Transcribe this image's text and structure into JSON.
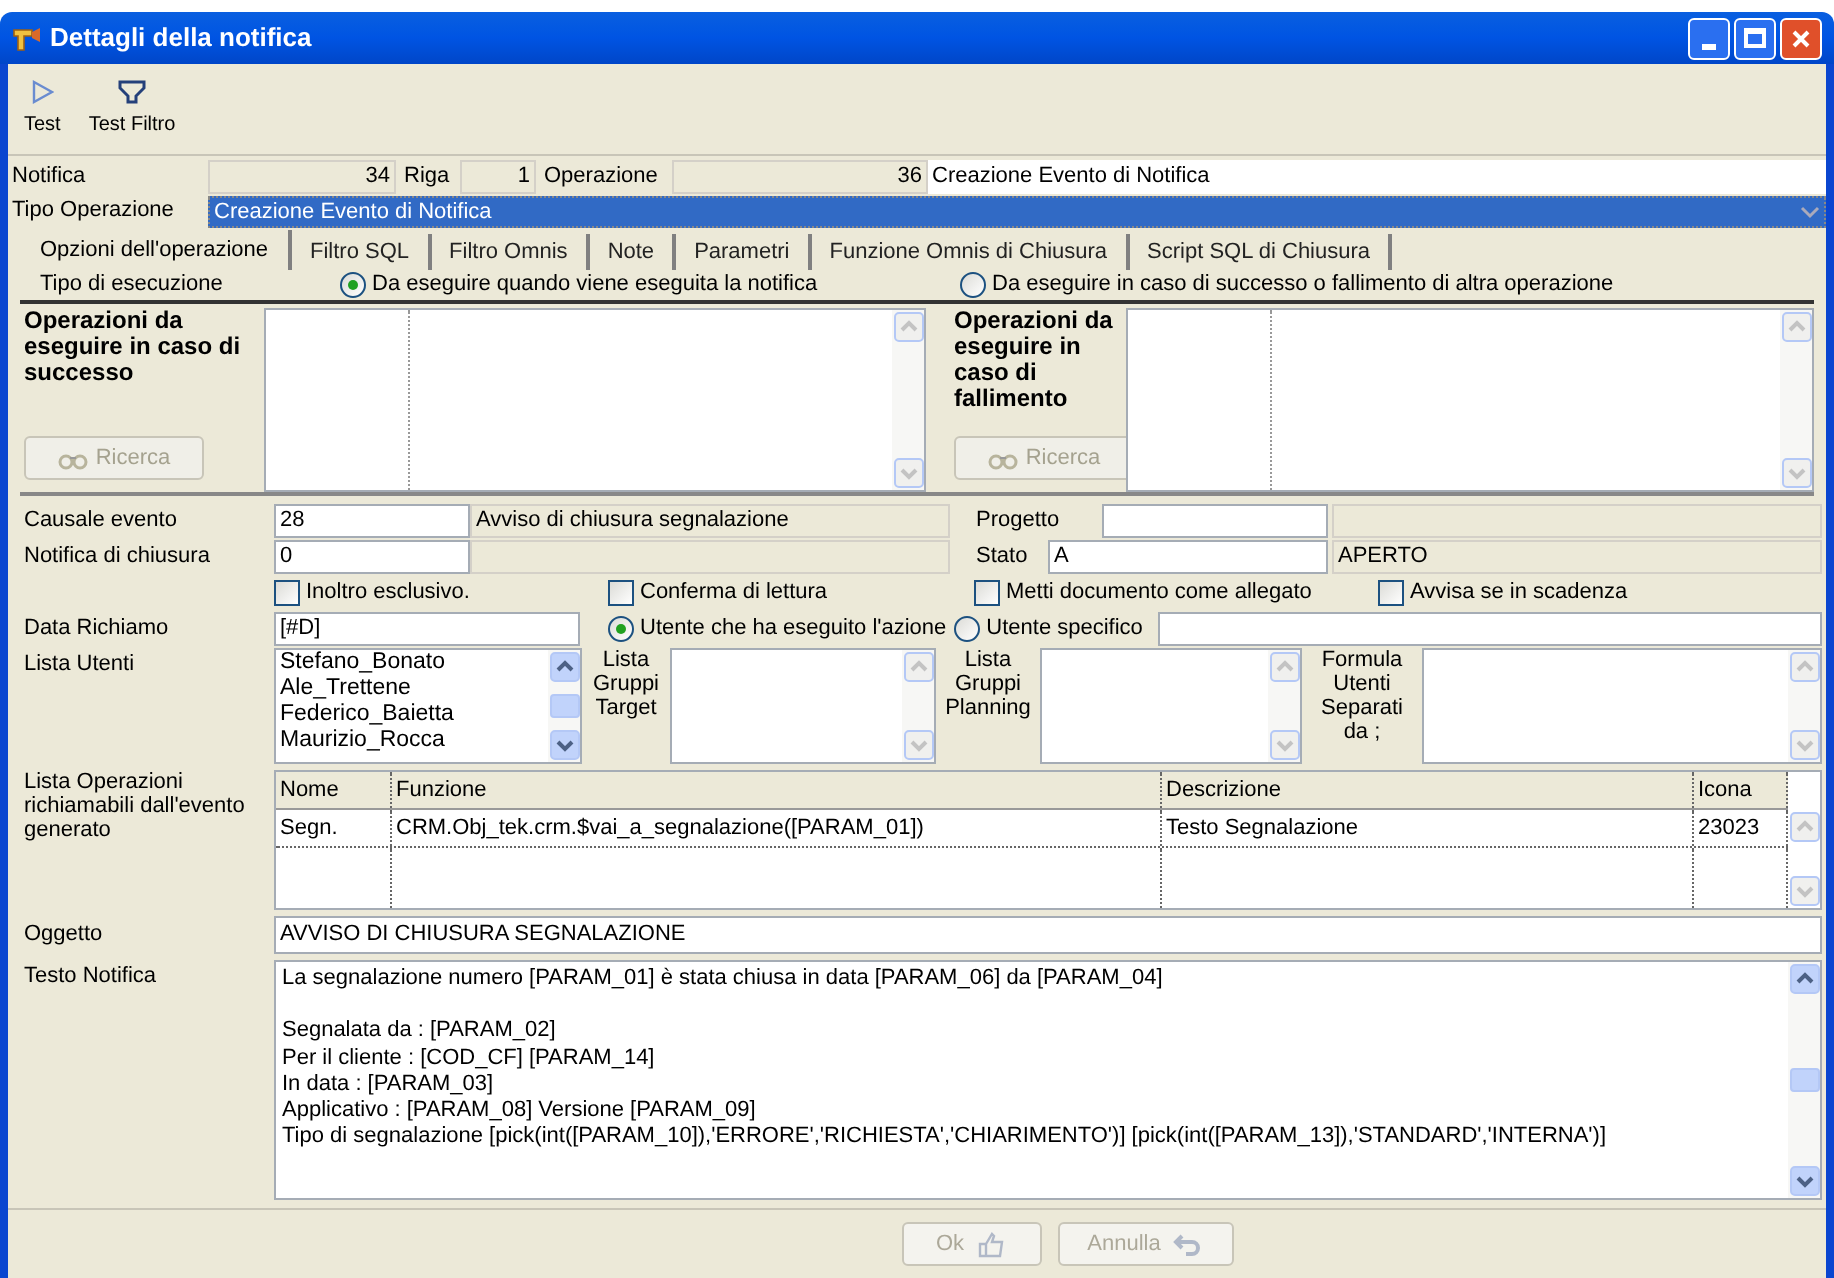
{
  "window": {
    "title": "Dettagli della notifica"
  },
  "toolbar": [
    {
      "label": "Test",
      "kind": "play"
    },
    {
      "label": "Test Filtro",
      "kind": "filter"
    }
  ],
  "header": {
    "notifica_label": "Notifica",
    "notifica": "34",
    "riga_label": "Riga",
    "riga": "1",
    "operazione_label": "Operazione",
    "operazione": "36",
    "operazione_name": "Creazione Evento di Notifica",
    "tipo_label": "Tipo Operazione",
    "tipo": "Creazione Evento di Notifica"
  },
  "tabs": [
    {
      "label": "Opzioni dell'operazione",
      "selected": true
    },
    {
      "label": "Filtro SQL",
      "selected": false
    },
    {
      "label": "Filtro Omnis",
      "selected": false
    },
    {
      "label": "Note",
      "selected": false
    },
    {
      "label": "Parametri",
      "selected": false
    },
    {
      "label": "Funzione Omnis di Chiusura",
      "selected": false
    },
    {
      "label": "Script SQL di Chiusura",
      "selected": false
    }
  ],
  "execution": {
    "label": "Tipo di esecuzione",
    "options": [
      {
        "label": "Da eseguire quando viene eseguita la notifica",
        "selected": true
      },
      {
        "label": "Da eseguire in caso di successo o fallimento di altra operazione",
        "selected": false
      }
    ]
  },
  "panels": [
    {
      "title": "Operazioni da eseguire in caso di successo",
      "button": "Ricerca",
      "disabled": true
    },
    {
      "title": "Operazioni da eseguire in caso di fallimento",
      "button": "Ricerca",
      "disabled": true
    }
  ],
  "causale": {
    "label": "Causale evento",
    "value": "28",
    "description": "Avviso di chiusura segnalazione"
  },
  "progetto": {
    "label": "Progetto"
  },
  "notifica_chiusura": {
    "label": "Notifica di chiusura",
    "value": "0"
  },
  "stato": {
    "label": "Stato",
    "value": "A",
    "description": "APERTO"
  },
  "checkboxes": [
    {
      "label": "Inoltro esclusivo.",
      "checked": false
    },
    {
      "label": "Conferma di lettura",
      "checked": false
    },
    {
      "label": "Metti documento come allegato",
      "checked": false
    },
    {
      "label": "Avvisa se in scadenza",
      "checked": false
    }
  ],
  "data_richiamo": {
    "label": "Data Richiamo",
    "value": "[#D]"
  },
  "user_options": [
    {
      "label": "Utente che ha eseguito l'azione",
      "selected": true
    },
    {
      "label": "Utente specifico",
      "selected": false
    }
  ],
  "lista_utenti": {
    "label": "Lista Utenti",
    "items": [
      "Stefano_Bonato",
      "Ale_Trettene",
      "Federico_Baietta",
      "Maurizio_Rocca"
    ]
  },
  "lista_gruppi_target": {
    "label": "Lista Gruppi Target"
  },
  "lista_gruppi_planning": {
    "label": "Lista Gruppi Planning"
  },
  "formula_utenti": {
    "label": "Formula Utenti Separati da ;"
  },
  "operazioni": {
    "label": "Lista Operazioni richiamabili dall'evento generato",
    "columns": [
      "Nome",
      "Funzione",
      "Descrizione",
      "Icona"
    ],
    "rows": [
      [
        "Segn.",
        "CRM.Obj_tek.crm.$vai_a_segnalazione([PARAM_01])",
        "Testo Segnalazione",
        "23023"
      ]
    ]
  },
  "oggetto": {
    "label": "Oggetto",
    "value": "AVVISO DI CHIUSURA SEGNALAZIONE"
  },
  "testo": {
    "label": "Testo Notifica",
    "paragraphs": [
      [
        "La segnalazione numero [PARAM_01] è stata chiusa in data [PARAM_06] da [PARAM_04]"
      ],
      [
        "Segnalata da : [PARAM_02]",
        "Per il cliente : [COD_CF]    [PARAM_14]",
        "In data : [PARAM_03]",
        "Applicativo : [PARAM_08] Versione [PARAM_09]",
        "Tipo di segnalazione [pick(int([PARAM_10]),'ERRORE','RICHIESTA','CHIARIMENTO')]     [pick(int([PARAM_13]),'STANDARD','INTERNA')]"
      ]
    ]
  },
  "buttons": [
    {
      "label": "Ok",
      "kind": "ok",
      "disabled": true
    },
    {
      "label": "Annulla",
      "kind": "cancel",
      "disabled": true
    }
  ]
}
